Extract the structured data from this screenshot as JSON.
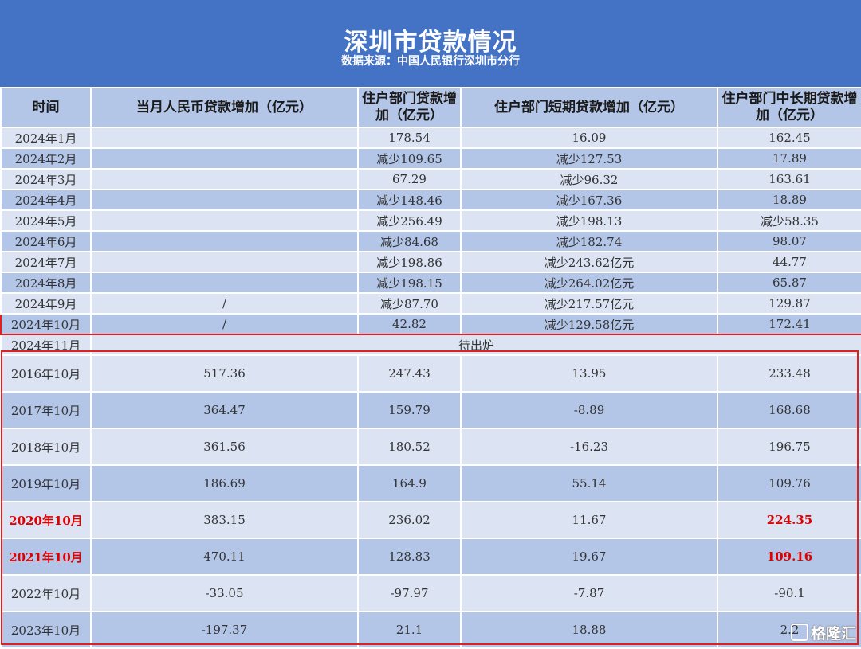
{
  "title": "深圳市贷款情况",
  "source": "数据来源：中国人民银行深圳市分行",
  "headers": {
    "time": "时间",
    "rmb_loan": "当月人民币贷款增加（亿元）",
    "household": "住户部门贷款增加（亿元）",
    "short_term": "住户部门短期贷款增加（亿元）",
    "long_term": "住户部门中长期贷款增加（亿元）"
  },
  "monthly_rows": [
    {
      "time": "2024年1月",
      "rmb": "",
      "household": "178.54",
      "short": "16.09",
      "long": "162.45"
    },
    {
      "time": "2024年2月",
      "rmb": "",
      "household": "减少109.65",
      "short": "减少127.53",
      "long": "17.89"
    },
    {
      "time": "2024年3月",
      "rmb": "",
      "household": "67.29",
      "short": "减少96.32",
      "long": "163.61"
    },
    {
      "time": "2024年4月",
      "rmb": "",
      "household": "减少148.46",
      "short": "减少167.36",
      "long": "18.89"
    },
    {
      "time": "2024年5月",
      "rmb": "",
      "household": "减少256.49",
      "short": "减少198.13",
      "long": "减少58.35"
    },
    {
      "time": "2024年6月",
      "rmb": "",
      "household": "减少84.68",
      "short": "减少182.74",
      "long": "98.07"
    },
    {
      "time": "2024年7月",
      "rmb": "",
      "household": "减少198.86",
      "short": "减少243.62亿元",
      "long": "44.77"
    },
    {
      "time": "2024年8月",
      "rmb": "",
      "household": "减少198.15",
      "short": "减少264.02亿元",
      "long": "65.87"
    },
    {
      "time": "2024年9月",
      "rmb": "/",
      "household": "减少87.70",
      "short": "减少217.57亿元",
      "long": "129.87"
    },
    {
      "time": "2024年10月",
      "rmb": "/",
      "household": "42.82",
      "short": "减少129.58亿元",
      "long": "172.41"
    }
  ],
  "pending_row": {
    "time": "2024年11月",
    "note": "待出炉"
  },
  "october_rows": [
    {
      "time": "2016年10月",
      "rmb": "517.36",
      "household": "247.43",
      "short": "13.95",
      "long": "233.48"
    },
    {
      "time": "2017年10月",
      "rmb": "364.47",
      "household": "159.79",
      "short": "-8.89",
      "long": "168.68"
    },
    {
      "time": "2018年10月",
      "rmb": "361.56",
      "household": "180.52",
      "short": "-16.23",
      "long": "196.75"
    },
    {
      "time": "2019年10月",
      "rmb": "186.69",
      "household": "164.9",
      "short": "55.14",
      "long": "109.76"
    },
    {
      "time": "2020年10月",
      "rmb": "383.15",
      "household": "236.02",
      "short": "11.67",
      "long": "224.35"
    },
    {
      "time": "2021年10月",
      "rmb": "470.11",
      "household": "128.83",
      "short": "19.67",
      "long": "109.16"
    },
    {
      "time": "2022年10月",
      "rmb": "-33.05",
      "household": "-97.97",
      "short": "-7.87",
      "long": "-90.1"
    },
    {
      "time": "2023年10月",
      "rmb": "-197.37",
      "household": "21.1",
      "short": "18.88",
      "long": "2.2"
    }
  ],
  "watermark": "格隆汇",
  "colors": {
    "banner": "#4472c4",
    "row_light": "#dce4f3",
    "row_dark": "#b4c6e7",
    "highlight": "#e02020"
  }
}
